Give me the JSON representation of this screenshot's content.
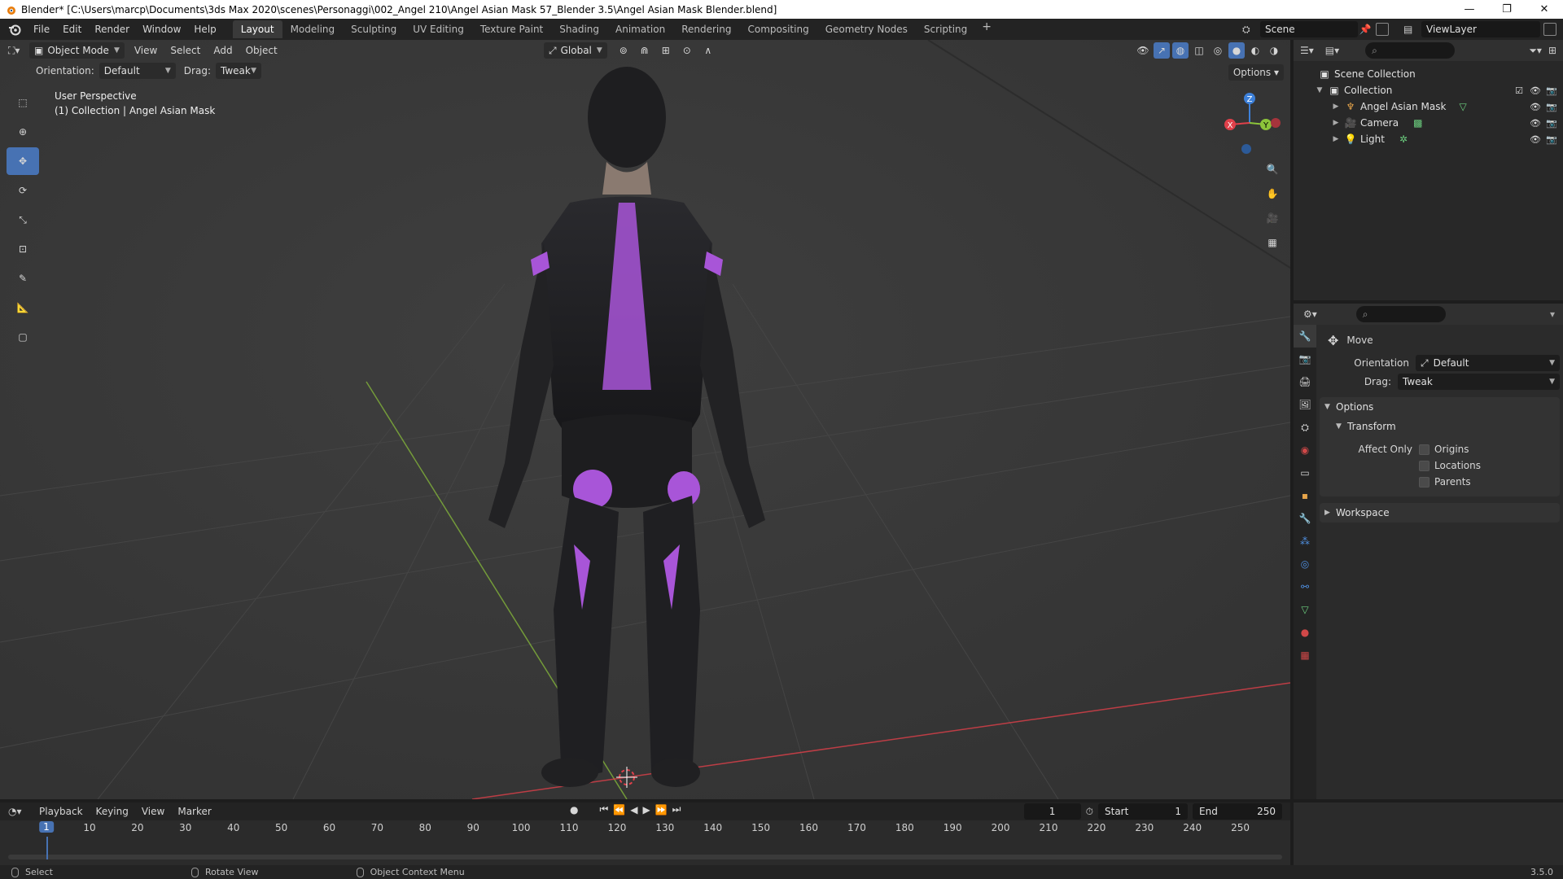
{
  "window": {
    "title": "Blender* [C:\\Users\\marcp\\Documents\\3ds Max 2020\\scenes\\Personaggi\\002_Angel 210\\Angel Asian Mask 57_Blender 3.5\\Angel Asian Mask Blender.blend]",
    "minimize": "—",
    "restore": "❐",
    "close": "✕"
  },
  "menu": [
    "File",
    "Edit",
    "Render",
    "Window",
    "Help"
  ],
  "workspaces": [
    "Layout",
    "Modeling",
    "Sculpting",
    "UV Editing",
    "Texture Paint",
    "Shading",
    "Animation",
    "Rendering",
    "Compositing",
    "Geometry Nodes",
    "Scripting"
  ],
  "active_workspace": "Layout",
  "scene_name": "Scene",
  "view_layer": "ViewLayer",
  "viewport": {
    "mode": "Object Mode",
    "menus": [
      "View",
      "Select",
      "Add",
      "Object"
    ],
    "transform_orientation": "Global",
    "tool_settings": {
      "orientation_label": "Orientation:",
      "orientation_value": "Default",
      "drag_label": "Drag:",
      "drag_value": "Tweak"
    },
    "options_label": "Options",
    "overlay_line1": "User Perspective",
    "overlay_line2": "(1) Collection | Angel Asian Mask",
    "gizmo_axes": {
      "z": "Z",
      "y": "Y",
      "x": "X"
    }
  },
  "outliner": {
    "root": "Scene Collection",
    "collection": "Collection",
    "items": [
      {
        "name": "Angel Asian Mask",
        "icon": "armature-icon"
      },
      {
        "name": "Camera",
        "icon": "camera-icon"
      },
      {
        "name": "Light",
        "icon": "light-icon"
      }
    ]
  },
  "properties": {
    "tool_name": "Move",
    "orientation_label": "Orientation",
    "orientation_value": "Default",
    "drag_label": "Drag:",
    "drag_value": "Tweak",
    "options_panel": "Options",
    "transform_panel": "Transform",
    "affect_only_label": "Affect Only",
    "affect_only": [
      "Origins",
      "Locations",
      "Parents"
    ],
    "workspace_panel": "Workspace"
  },
  "timeline": {
    "menus": [
      "Playback",
      "Keying",
      "View",
      "Marker"
    ],
    "current_frame": "1",
    "start_label": "Start",
    "start_value": "1",
    "end_label": "End",
    "end_value": "250",
    "ruler": [
      "1",
      "10",
      "20",
      "30",
      "40",
      "50",
      "60",
      "70",
      "80",
      "90",
      "100",
      "110",
      "120",
      "130",
      "140",
      "150",
      "160",
      "170",
      "180",
      "190",
      "200",
      "210",
      "220",
      "230",
      "240",
      "250"
    ]
  },
  "statusbar": {
    "select": "Select",
    "rotate": "Rotate View",
    "context": "Object Context Menu",
    "version": "3.5.0"
  },
  "colors": {
    "accent": "#4772b3",
    "suit_purple": "#a855d8",
    "axis_x": "#e0404a",
    "axis_y": "#8cc43a",
    "axis_z": "#3d80d9"
  }
}
